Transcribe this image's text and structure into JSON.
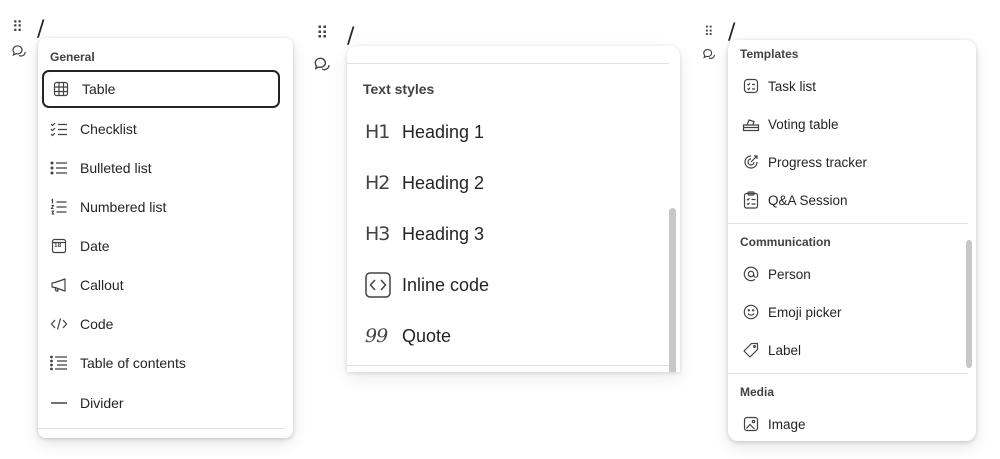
{
  "handles": {
    "glyph": "⠿"
  },
  "slash": "/",
  "panel1": {
    "section": "General",
    "items": [
      {
        "label": "Table",
        "icon": "table-icon"
      },
      {
        "label": "Checklist",
        "icon": "checklist-icon"
      },
      {
        "label": "Bulleted list",
        "icon": "bulleted-list-icon"
      },
      {
        "label": "Numbered list",
        "icon": "numbered-list-icon"
      },
      {
        "label": "Date",
        "icon": "calendar-icon",
        "icon_text": "18"
      },
      {
        "label": "Callout",
        "icon": "megaphone-icon"
      },
      {
        "label": "Code",
        "icon": "code-icon"
      },
      {
        "label": "Table of contents",
        "icon": "table-of-contents-icon"
      },
      {
        "label": "Divider",
        "icon": "divider-icon"
      }
    ]
  },
  "panel2": {
    "section": "Text styles",
    "items": [
      {
        "label": "Heading 1",
        "icon": "heading-1-icon",
        "icon_text": "H1"
      },
      {
        "label": "Heading 2",
        "icon": "heading-2-icon",
        "icon_text": "H2"
      },
      {
        "label": "Heading 3",
        "icon": "heading-3-icon",
        "icon_text": "H3"
      },
      {
        "label": "Inline code",
        "icon": "inline-code-icon"
      },
      {
        "label": "Quote",
        "icon": "quote-icon",
        "icon_text": "99"
      }
    ]
  },
  "panel3": {
    "sections": {
      "templates": "Templates",
      "communication": "Communication",
      "media": "Media"
    },
    "templates": [
      {
        "label": "Task list",
        "icon": "task-list-icon"
      },
      {
        "label": "Voting table",
        "icon": "voting-table-icon"
      },
      {
        "label": "Progress tracker",
        "icon": "progress-tracker-icon"
      },
      {
        "label": "Q&A Session",
        "icon": "clipboard-icon"
      }
    ],
    "communication": [
      {
        "label": "Person",
        "icon": "at-sign-icon"
      },
      {
        "label": "Emoji picker",
        "icon": "emoji-icon"
      },
      {
        "label": "Label",
        "icon": "tag-icon"
      }
    ],
    "media": [
      {
        "label": "Image",
        "icon": "image-icon"
      }
    ]
  }
}
